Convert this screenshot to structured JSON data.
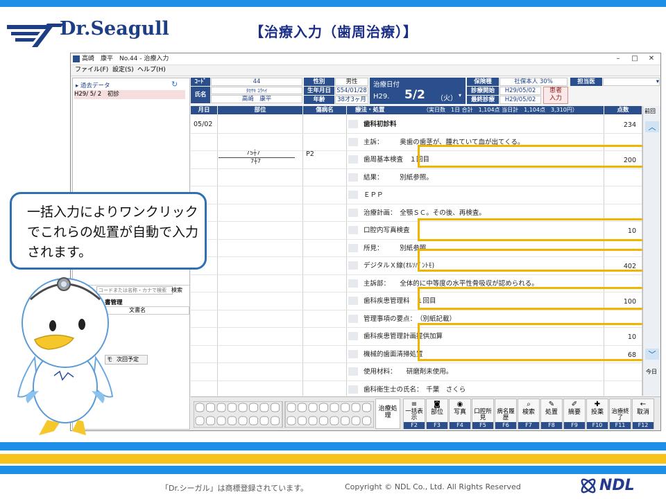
{
  "slide": {
    "title": "【治療入力（歯周治療）】",
    "logo": "Dr.Seagull",
    "callout": "一括入力によりワンクリックでこれらの処置が自動で入力されます。",
    "trademark": "「Dr.シーガル」は商標登録されています。",
    "copyright": "Copyright © NDL Co., Ltd. All Rights Reserved",
    "company": "NDL"
  },
  "window": {
    "title": "高崎　康平　No.44 - 治療入力",
    "menu": [
      "ファイル(F)",
      "設定(S)",
      "ヘルプ(H)"
    ]
  },
  "left_pane": {
    "past_data_label": "過去データ",
    "history_date": "H29/ 5/ 2",
    "history_label": "初診",
    "search_placeholder": "コードまたは名称・カナで検索",
    "search_button": "検索",
    "section_title": "書管理",
    "doc_col": "文書名",
    "tab1": "モ",
    "tab2": "次回予定"
  },
  "patient": {
    "code_label": "ｺｰﾄﾞ",
    "code": "44",
    "name_label": "氏名",
    "kana": "ﾀｶｻｷ ｺｳﾍｲ",
    "name": "高崎　康平",
    "sex_label": "性別",
    "sex": "男性",
    "birth_label": "生年月日",
    "birth": "S54/01/28",
    "age_label": "年齢",
    "age": "38才3ヶ月",
    "date_label": "治療日付",
    "era": "H29.",
    "date": "5/2",
    "weekday": "（火）",
    "insurance_label": "保険種",
    "insurance": "社保本人 30%",
    "start_label": "診療開始",
    "start": "H29/05/02",
    "last_label": "最終診療",
    "last": "H29/05/02",
    "patient_btn_1": "患者",
    "patient_btn_2": "入力",
    "doctor_label": "担当医"
  },
  "grid": {
    "headers": [
      "月日",
      "部位",
      "傷病名",
      "療法・処置",
      "点数"
    ],
    "summary": "（実日数　1日 合計　1,104点 当日計　1,104点　3,310円）",
    "date": "05/02",
    "tooth_upper": "75┼7",
    "tooth_lower": "7┼7",
    "disease": "P2",
    "prev_button": "前回",
    "today_button": "今日",
    "rows": [
      {
        "text": "歯科初診料",
        "points": "234"
      },
      {
        "text": "主訴：　　　奥歯の歯茎が、腫れていて血が出てくる。",
        "points": ""
      },
      {
        "text": "歯周基本検査　１回目",
        "points": "200"
      },
      {
        "text": "結果：　　　別紙参照。",
        "points": ""
      },
      {
        "text": "ＥＰＰ",
        "points": ""
      },
      {
        "text": "治療計画：　全顎ＳＣ。その後、再検査。",
        "points": ""
      },
      {
        "text": "口腔内写真検査",
        "points": "10"
      },
      {
        "text": "所見：　　　別紙参照",
        "points": ""
      },
      {
        "text": "デジタルＸ線(ｵﾙｿﾊﾟﾝﾄﾓ)",
        "points": "402"
      },
      {
        "text": "主訴部：　　全体的に中等度の水平性骨吸収が認められる。",
        "points": ""
      },
      {
        "text": "歯科疾患管理料　１回目",
        "points": "100"
      },
      {
        "text": "管理事項の要点：　（別紙記載）",
        "points": ""
      },
      {
        "text": "歯科疾患管理計画提供加算",
        "points": "10"
      },
      {
        "text": "機械的歯面清掃処置",
        "points": "68"
      },
      {
        "text": "使用材料：　　研磨剤未使用。",
        "points": ""
      },
      {
        "text": "歯科衛生士の氏名：　千葉　さくら",
        "points": ""
      }
    ]
  },
  "toolbar": {
    "main": "治療処理",
    "buttons": [
      {
        "label": "一括表示",
        "key": "F2",
        "icon": "list-icon"
      },
      {
        "label": "部位",
        "key": "F3",
        "icon": "tooth-icon"
      },
      {
        "label": "写真",
        "key": "F4",
        "icon": "camera-icon"
      },
      {
        "label": "口腔所見",
        "key": "F5",
        "icon": "none"
      },
      {
        "label": "病名履歴",
        "key": "F6",
        "icon": "none"
      },
      {
        "label": "検索",
        "key": "F7",
        "icon": "search-icon"
      },
      {
        "label": "処置",
        "key": "F8",
        "icon": "tool-icon"
      },
      {
        "label": "摘要",
        "key": "F9",
        "icon": "pencil-icon"
      },
      {
        "label": "投薬",
        "key": "F10",
        "icon": "medicine-icon"
      },
      {
        "label": "治療終了",
        "key": "F11",
        "icon": "none"
      },
      {
        "label": "取消",
        "key": "F12",
        "icon": "back-arrow-icon"
      }
    ]
  },
  "colors": {
    "accent": "#2b4f8c",
    "highlight": "#f1b400",
    "band_blue": "#1e8fe6",
    "band_yellow": "#f7c21a"
  }
}
